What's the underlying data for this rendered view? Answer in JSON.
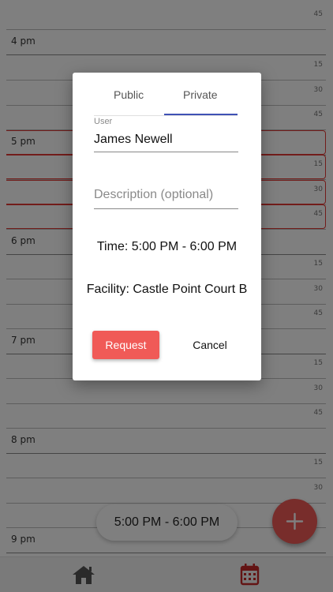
{
  "schedule": {
    "hours": [
      {
        "label": "4 pm"
      },
      {
        "label": "5 pm"
      },
      {
        "label": "6 pm"
      },
      {
        "label": "7 pm"
      },
      {
        "label": "8 pm"
      },
      {
        "label": "9 pm"
      }
    ],
    "minutes": [
      "15",
      "30",
      "45"
    ]
  },
  "dialog": {
    "tabs": {
      "public": "Public",
      "private": "Private"
    },
    "active_tab": "private",
    "user_label": "User",
    "user_value": "James Newell",
    "description_placeholder": "Description (optional)",
    "time_text": "Time: 5:00  PM - 6:00  PM",
    "facility_text": "Facility: Castle  Point Court  B",
    "request_label": "Request",
    "cancel_label": "Cancel"
  },
  "selected_time": "5:00  PM - 6:00  PM",
  "colors": {
    "accent": "#f05a57",
    "tab_indicator": "#3f51b5",
    "booked_border": "#e53935"
  },
  "nav": {
    "home_icon": "home-icon",
    "calendar_icon": "calendar-icon"
  },
  "fab_icon": "plus-icon"
}
